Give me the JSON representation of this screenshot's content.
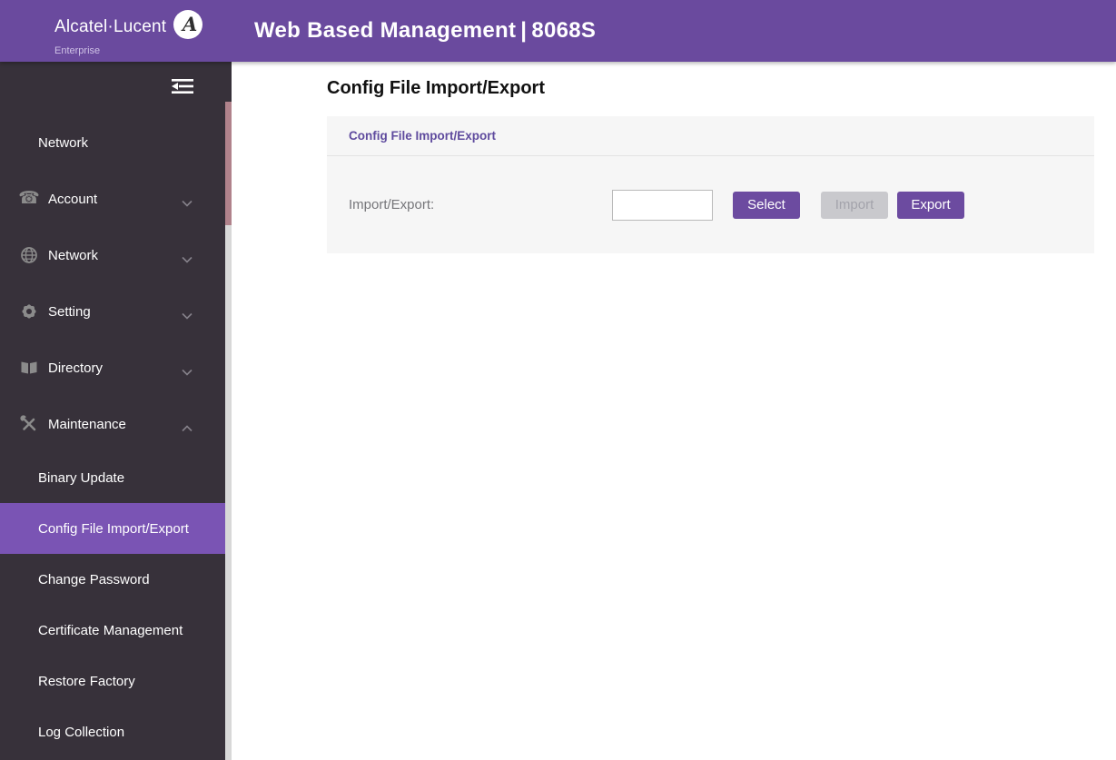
{
  "header": {
    "brand": "Alcatel·Lucent",
    "brand_sub": "Enterprise",
    "title": "Web Based Management",
    "separator": "|",
    "model": "8068S"
  },
  "sidebar": {
    "items": [
      {
        "label": "Network",
        "type": "main",
        "icon": null,
        "chevron": null
      },
      {
        "label": "Account",
        "type": "main",
        "icon": "phone-icon",
        "chevron": "down"
      },
      {
        "label": "Network",
        "type": "main",
        "icon": "globe-icon",
        "chevron": "down"
      },
      {
        "label": "Setting",
        "type": "main",
        "icon": "gear-icon",
        "chevron": "down"
      },
      {
        "label": "Directory",
        "type": "main",
        "icon": "book-icon",
        "chevron": "down"
      },
      {
        "label": "Maintenance",
        "type": "main",
        "icon": "tools-icon",
        "chevron": "up"
      },
      {
        "label": "Binary Update",
        "type": "sub"
      },
      {
        "label": "Config File Import/Export",
        "type": "sub",
        "active": true
      },
      {
        "label": "Change Password",
        "type": "sub"
      },
      {
        "label": "Certificate Management",
        "type": "sub"
      },
      {
        "label": "Restore Factory",
        "type": "sub"
      },
      {
        "label": "Log Collection",
        "type": "sub"
      }
    ]
  },
  "main": {
    "page_title": "Config File Import/Export",
    "panel": {
      "header": "Config File Import/Export",
      "field_label": "Import/Export:",
      "file_input_value": "",
      "buttons": [
        {
          "label": "Select",
          "state": "enabled"
        },
        {
          "label": "Import",
          "state": "disabled"
        },
        {
          "label": "Export",
          "state": "enabled"
        }
      ]
    }
  },
  "colors": {
    "header_purple": "#6a4a9e",
    "sidebar_dark": "#37313a",
    "active_item_purple": "#7a54b4",
    "button_purple": "#6c4ba0",
    "disabled_gray": "#c9c9cd",
    "panel_gray": "#f6f6f6",
    "scroll_thumb": "#b0828b"
  }
}
